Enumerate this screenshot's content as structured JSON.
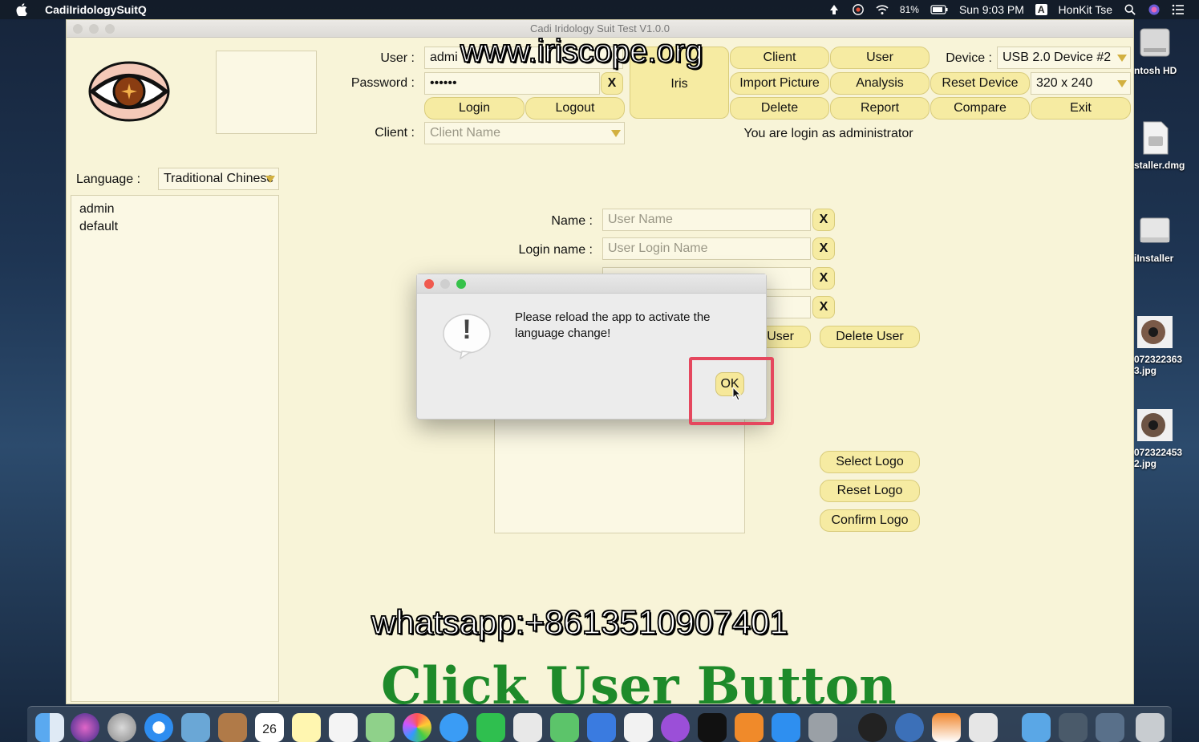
{
  "menubar": {
    "app_name": "CadiIridologySuitQ",
    "battery": "81%",
    "clock": "Sun 9:03 PM",
    "input_source": "A",
    "user": "HonKit Tse"
  },
  "window": {
    "title": "Cadi Iridology Suit Test V1.0.0"
  },
  "login": {
    "user_label": "User :",
    "user_value": "admi",
    "password_label": "Password :",
    "password_value": "••••••",
    "clear_label": "X",
    "login_button": "Login",
    "logout_button": "Logout",
    "client_label": "Client :",
    "client_placeholder": "Client Name"
  },
  "toolbar": {
    "iris": "Iris",
    "client": "Client",
    "user": "User",
    "import_picture": "Import Picture",
    "analysis": "Analysis",
    "reset_device": "Reset Device",
    "delete": "Delete",
    "report": "Report",
    "compare": "Compare",
    "exit": "Exit",
    "device_label": "Device :",
    "device_value": "USB 2.0 Device #2",
    "resolution_value": "320 x 240",
    "status": "You are login as administrator"
  },
  "language": {
    "label": "Language :",
    "value": "Traditional Chinese"
  },
  "users_list": [
    "admin",
    "default"
  ],
  "user_form": {
    "name_label": "Name :",
    "name_placeholder": "User Name",
    "login_name_label": "Login name :",
    "login_name_placeholder": "User Login Name",
    "clear_label": "X",
    "add_user_partial": "User",
    "delete_user": "Delete User",
    "select_logo": "Select Logo",
    "reset_logo": "Reset Logo",
    "confirm_logo": "Confirm Logo"
  },
  "dialog": {
    "message": "Please reload the app to activate the language change!",
    "icon_glyph": "!",
    "ok": "OK"
  },
  "overlay": {
    "website": "www.iriscope.org",
    "whatsapp": "whatsapp:+8613510907401",
    "caption": "Click User Button"
  },
  "desktop_icons": [
    {
      "label": "ntosh HD"
    },
    {
      "label": "staller.dmg"
    },
    {
      "label": "iInstaller"
    },
    {
      "label": "072322363\n3.jpg"
    },
    {
      "label": "072322453\n2.jpg"
    }
  ],
  "dock": {
    "calendar_day": "26"
  },
  "colors": {
    "window_bg": "#f8f4d8",
    "button_bg": "#f6eba2",
    "highlight": "#e5475e",
    "caption": "#1e8a2a"
  }
}
